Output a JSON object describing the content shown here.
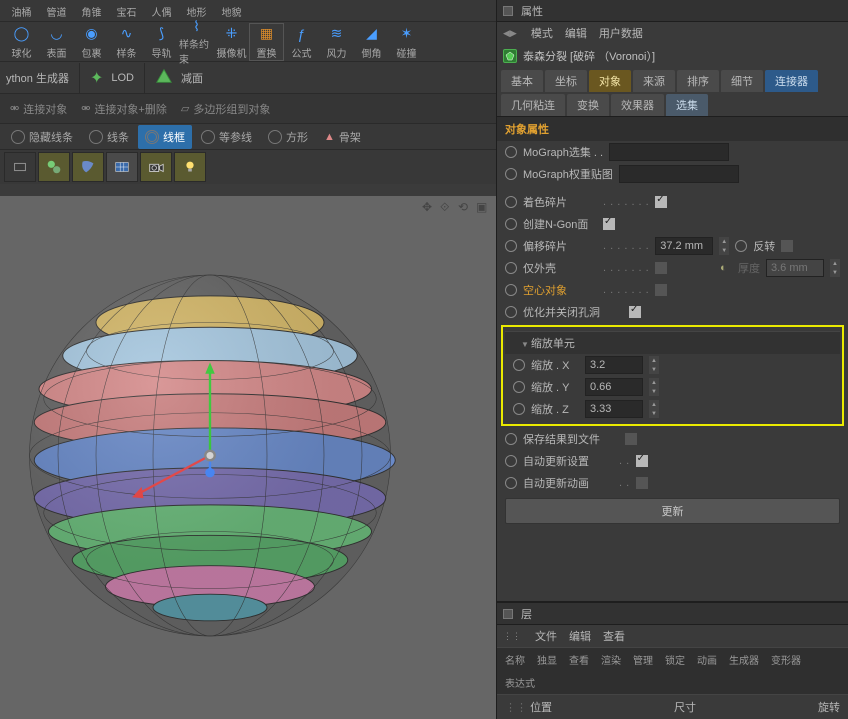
{
  "top_tools": [
    {
      "label": "油桶",
      "name": "oil-barrel"
    },
    {
      "label": "管道",
      "name": "pipe"
    },
    {
      "label": "角锥",
      "name": "pyramid"
    },
    {
      "label": "宝石",
      "name": "gem"
    },
    {
      "label": "人偶",
      "name": "figure"
    },
    {
      "label": "地形",
      "name": "terrain"
    },
    {
      "label": "地貌",
      "name": "landscape"
    }
  ],
  "second_row_tools": [
    {
      "label": "球化",
      "name": "spherify"
    },
    {
      "label": "表面",
      "name": "surface"
    },
    {
      "label": "包裹",
      "name": "wrap"
    },
    {
      "label": "样条",
      "name": "spline"
    },
    {
      "label": "导轨",
      "name": "rail"
    },
    {
      "label": "样条约束",
      "name": "spline-constraint"
    },
    {
      "label": "摄像机",
      "name": "camera"
    },
    {
      "label": "置换",
      "name": "displace",
      "highlight": true
    },
    {
      "label": "公式",
      "name": "formula"
    },
    {
      "label": "风力",
      "name": "wind"
    },
    {
      "label": "倒角",
      "name": "bevel"
    },
    {
      "label": "碰撞",
      "name": "collision"
    }
  ],
  "lod_row": {
    "python_gen": "ython 生成器",
    "lod": "LOD",
    "reduce": "减面"
  },
  "conn_row": {
    "link_obj": "连接对象",
    "link_obj_del": "连接对象+删除",
    "poly_group": "多边形组到对象"
  },
  "display_modes": {
    "hide": "隐藏线条",
    "lines": "线条",
    "wireframe": "线框",
    "isoparm": "等参线",
    "box": "方形",
    "skeleton": "骨架"
  },
  "attributes_title": "属性",
  "attributes_menu": {
    "mode": "模式",
    "edit": "编辑",
    "userdata": "用户数据"
  },
  "object_title": "泰森分裂 [破碎 （Voronoi）]",
  "tabs1": {
    "basic": "基本",
    "coord": "坐标",
    "object": "对象",
    "source": "来源",
    "sort": "排序",
    "detail": "细节",
    "connector": "连接器"
  },
  "tabs2": {
    "geomglue": "几何粘连",
    "transform": "变换",
    "effector": "效果器",
    "selection": "选集"
  },
  "section_obj_attrs": "对象属性",
  "rows": {
    "mograph_sel": "MoGraph选集 . .",
    "mograph_weight": "MoGraph权重贴图",
    "color_shards": "着色碎片",
    "create_ngon": "创建N-Gon面",
    "offset_shards": "偏移碎片",
    "offset_val": "37.2 mm",
    "reverse": "反转",
    "shell_only": "仅外壳",
    "thickness": "厚度",
    "thickness_val": "3.6 mm",
    "hollow": "空心对象",
    "optimize_close": "优化并关闭孔洞"
  },
  "scale_section": "缩放单元",
  "scale": {
    "x_label": "缩放 . X",
    "x_val": "3.2",
    "y_label": "缩放 . Y",
    "y_val": "0.66",
    "z_label": "缩放 . Z",
    "z_val": "3.33"
  },
  "save_rows": {
    "save_result": "保存结果到文件",
    "auto_update_set": "自动更新设置",
    "auto_update_anim": "自动更新动画"
  },
  "update_btn": "更新",
  "layers_title": "层",
  "layers_menu": {
    "file": "文件",
    "edit": "编辑",
    "view": "查看"
  },
  "layer_cols": [
    "名称",
    "独显",
    "查看",
    "渲染",
    "管理",
    "锁定",
    "动画",
    "生成器",
    "变形器",
    "表达式"
  ],
  "bottom": {
    "pos": "位置",
    "size": "尺寸",
    "rot": "旋转"
  }
}
